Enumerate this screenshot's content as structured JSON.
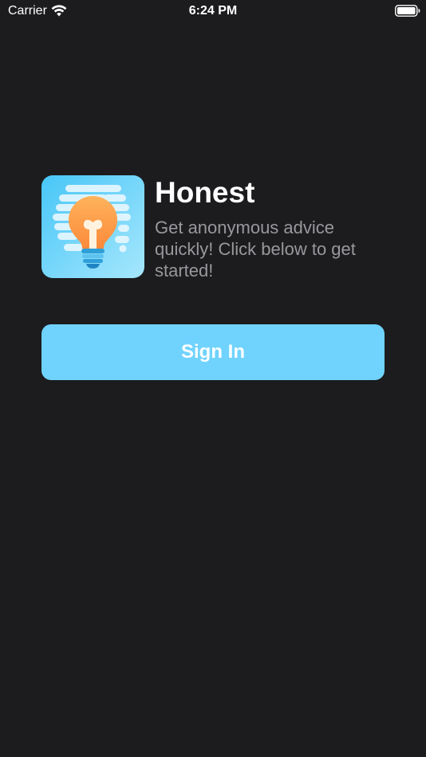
{
  "status_bar": {
    "carrier": "Carrier",
    "time": "6:24 PM",
    "icons": [
      "wifi-icon",
      "battery-icon"
    ]
  },
  "app": {
    "title": "Honest",
    "subtitle": "Get anonymous advice quickly! Click below to get started!",
    "icon": "lightbulb-icon"
  },
  "actions": {
    "sign_in_label": "Sign In"
  },
  "colors": {
    "background": "#1c1c1e",
    "button": "#6fd3fd",
    "subtitle": "#98989d",
    "text": "#ffffff"
  }
}
